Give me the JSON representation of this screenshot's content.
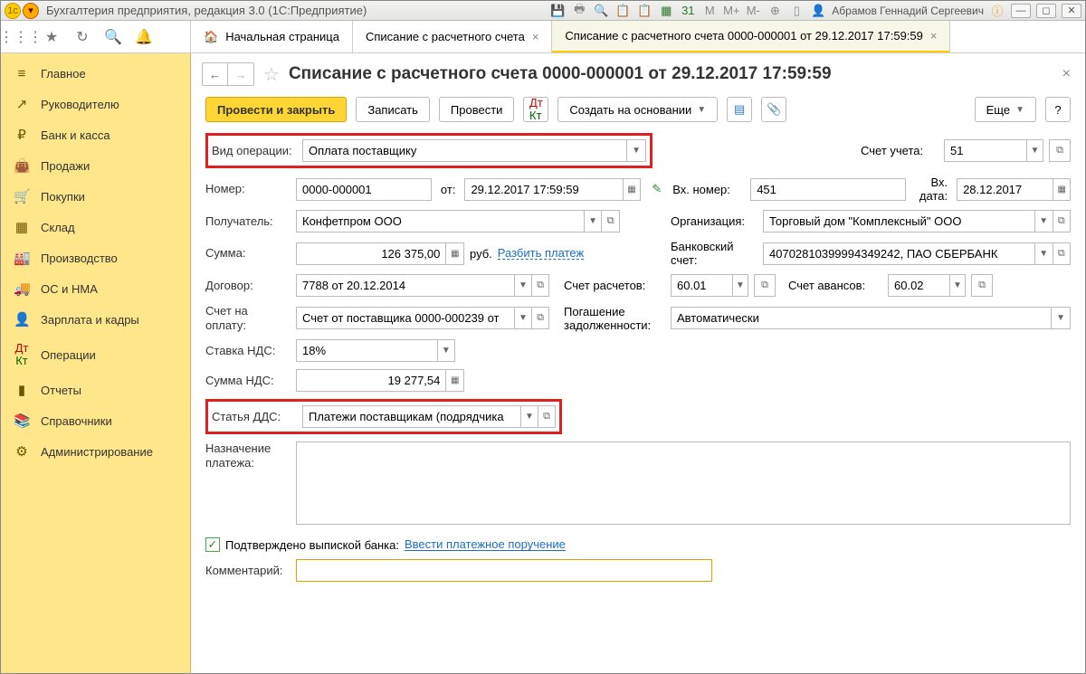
{
  "titlebar": {
    "app": "Бухгалтерия предприятия, редакция 3.0  (1С:Предприятие)",
    "user": "Абрамов Геннадий Сергеевич",
    "m1": "М",
    "m2": "М+",
    "m3": "М-"
  },
  "tabs": {
    "home": "Начальная страница",
    "t1": "Списание с расчетного счета",
    "t2": "Списание с расчетного счета 0000-000001 от 29.12.2017 17:59:59"
  },
  "sidebar": {
    "items": [
      {
        "icon": "≡",
        "label": "Главное"
      },
      {
        "icon": "↗",
        "label": "Руководителю"
      },
      {
        "icon": "₽",
        "label": "Банк и касса"
      },
      {
        "icon": "👜",
        "label": "Продажи"
      },
      {
        "icon": "🛒",
        "label": "Покупки"
      },
      {
        "icon": "▦",
        "label": "Склад"
      },
      {
        "icon": "🏭",
        "label": "Производство"
      },
      {
        "icon": "🚚",
        "label": "ОС и НМА"
      },
      {
        "icon": "👤",
        "label": "Зарплата и кадры"
      },
      {
        "icon": "Дт",
        "label": "Операции"
      },
      {
        "icon": "▮",
        "label": "Отчеты"
      },
      {
        "icon": "📚",
        "label": "Справочники"
      },
      {
        "icon": "⚙",
        "label": "Администрирование"
      }
    ]
  },
  "page": {
    "title": "Списание с расчетного счета 0000-000001 от 29.12.2017 17:59:59"
  },
  "actions": {
    "post_close": "Провести и закрыть",
    "write": "Записать",
    "post": "Провести",
    "create_from": "Создать на основании",
    "more": "Еще",
    "help": "?"
  },
  "form": {
    "op_type_lbl": "Вид операции:",
    "op_type": "Оплата поставщику",
    "acc_lbl": "Счет учета:",
    "acc": "51",
    "num_lbl": "Номер:",
    "num": "0000-000001",
    "from_lbl": "от:",
    "dt": "29.12.2017 17:59:59",
    "ext_num_lbl": "Вх. номер:",
    "ext_num": "451",
    "ext_date_lbl": "Вх. дата:",
    "ext_date": "28.12.2017",
    "recv_lbl": "Получатель:",
    "recv": "Конфетпром ООО",
    "org_lbl": "Организация:",
    "org": "Торговый дом \"Комплексный\" ООО",
    "sum_lbl": "Сумма:",
    "sum": "126 375,00",
    "rub": "руб.",
    "split": "Разбить платеж",
    "bank_lbl": "Банковский счет:",
    "bank": "40702810399994349242, ПАО СБЕРБАНК",
    "contract_lbl": "Договор:",
    "contract": "7788 от 20.12.2014",
    "settle_lbl": "Счет расчетов:",
    "settle": "60.01",
    "advance_lbl": "Счет авансов:",
    "advance": "60.02",
    "invoice_lbl": "Счет на оплату:",
    "invoice": "Счет от поставщика 0000-000239 от",
    "debt_lbl": "Погашение задолженности:",
    "debt": "Автоматически",
    "vat_rate_lbl": "Ставка НДС:",
    "vat_rate": "18%",
    "vat_sum_lbl": "Сумма НДС:",
    "vat_sum": "19 277,54",
    "dds_lbl": "Статья ДДС:",
    "dds": "Платежи поставщикам (подрядчика",
    "purpose_lbl": "Назначение платежа:",
    "confirmed": "Подтверждено выпиской банка:",
    "enter_pp": "Ввести платежное поручение",
    "comment_lbl": "Комментарий:"
  }
}
